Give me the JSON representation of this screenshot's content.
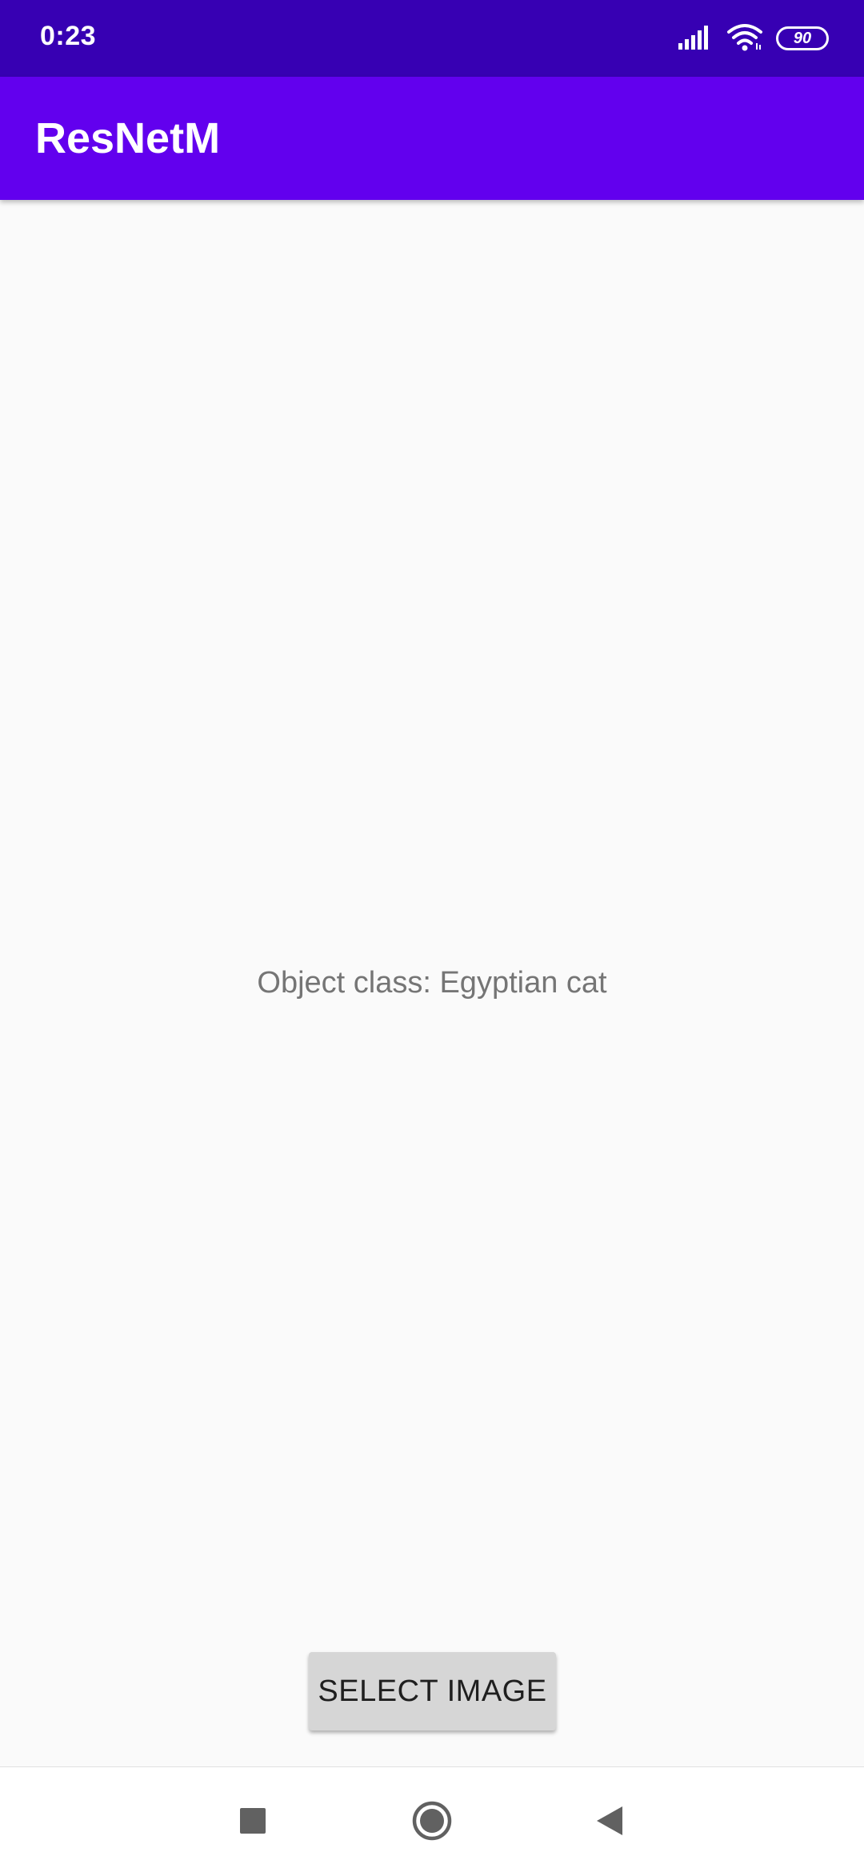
{
  "status_bar": {
    "time": "0:23",
    "battery_level": "90",
    "icons": [
      "signal-icon",
      "wifi-icon",
      "battery-icon"
    ]
  },
  "app_bar": {
    "title": "ResNetM",
    "color": "#6200ee"
  },
  "main": {
    "result_text": "Object class: Egyptian cat",
    "select_button_label": "SELECT IMAGE"
  },
  "navigation": {
    "buttons": [
      "recents-icon",
      "home-icon",
      "back-icon"
    ]
  },
  "colors": {
    "status_bar": "#3700b3",
    "app_bar": "#6200ee",
    "background": "#fafafa",
    "button": "#d6d6d6"
  }
}
